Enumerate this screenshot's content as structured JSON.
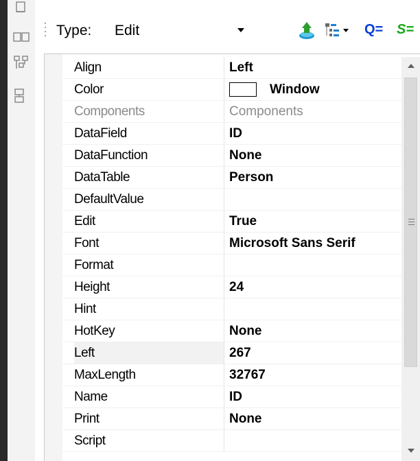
{
  "toolbar": {
    "type_label": "Type:",
    "type_value": "Edit",
    "icons": [
      "export-icon",
      "tree-list-icon",
      "q-equals-icon",
      "s-equals-icon"
    ],
    "q_label": "Q=",
    "s_label": "S="
  },
  "sidebar_icons": [
    "align-top-icon",
    "align-horizontal-icon",
    "align-tree-icon",
    "align-vertical-icon"
  ],
  "properties": [
    {
      "name": "Align",
      "value": "Left"
    },
    {
      "name": "Color",
      "value": "Window"
    },
    {
      "name": "Components",
      "value": "Components"
    },
    {
      "name": "DataField",
      "value": "ID"
    },
    {
      "name": "DataFunction",
      "value": "None"
    },
    {
      "name": "DataTable",
      "value": "Person"
    },
    {
      "name": "DefaultValue",
      "value": ""
    },
    {
      "name": "Edit",
      "value": "True"
    },
    {
      "name": "Font",
      "value": "Microsoft Sans Serif"
    },
    {
      "name": "Format",
      "value": ""
    },
    {
      "name": "Height",
      "value": "24"
    },
    {
      "name": "Hint",
      "value": ""
    },
    {
      "name": "HotKey",
      "value": "None"
    },
    {
      "name": "Left",
      "value": "267"
    },
    {
      "name": "MaxLength",
      "value": "32767"
    },
    {
      "name": "Name",
      "value": "ID"
    },
    {
      "name": "Print",
      "value": "None"
    },
    {
      "name": "Script",
      "value": ""
    }
  ],
  "colors": {
    "swatch": "#ffffff",
    "q_button": "#0a3fd6",
    "s_button": "#1aa61a",
    "disabled_text": "#8a8a8a"
  }
}
